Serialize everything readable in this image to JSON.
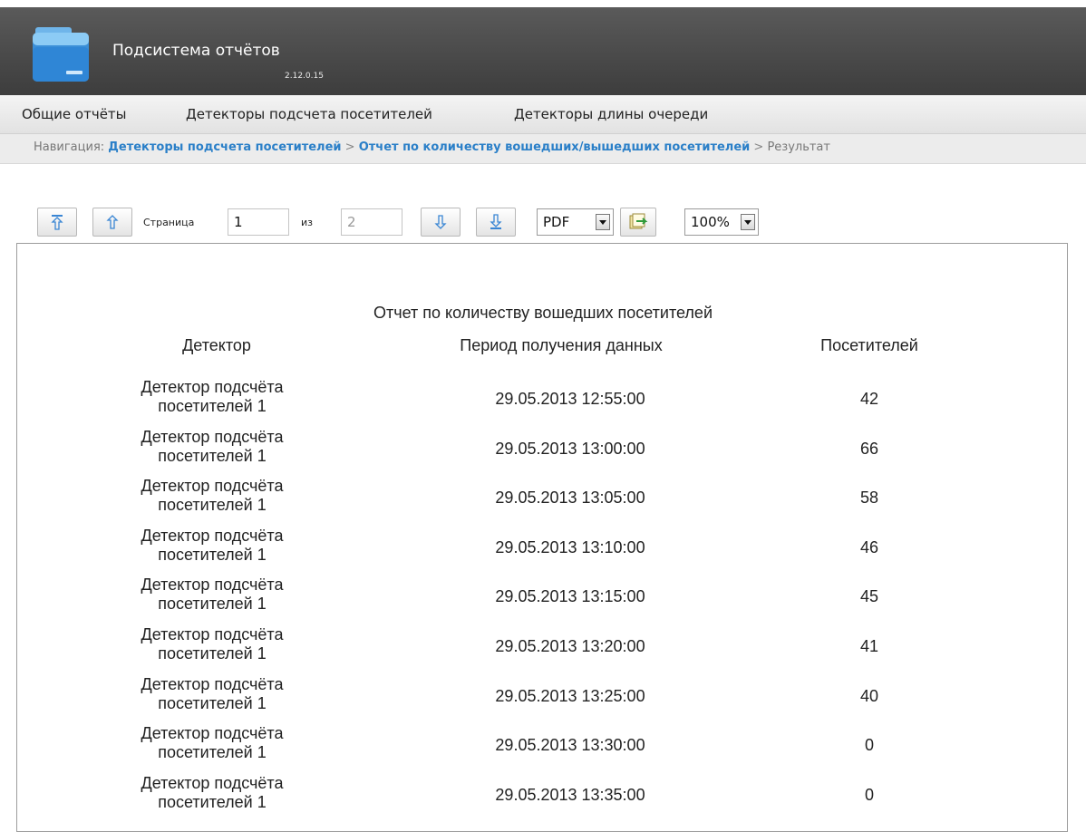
{
  "app": {
    "title": "Подсистема отчётов",
    "version": "2.12.0.15"
  },
  "menu": [
    {
      "label": "Общие отчёты"
    },
    {
      "label": "Детекторы подсчета посетителей"
    },
    {
      "label": "Детекторы длины очереди"
    }
  ],
  "breadcrumb": {
    "prefix": "Навигация:",
    "link1": "Детекторы подсчета посетителей",
    "sep": ">",
    "link2": "Отчет по количеству вошедших/вышедших посетителей",
    "current": "Результат"
  },
  "toolbar": {
    "page_label": "Страница",
    "page_value": "1",
    "of_label": "из",
    "total_pages": "2",
    "format": "PDF",
    "zoom": "100%"
  },
  "report": {
    "title": "Отчет по количеству вошедших посетителей",
    "columns": [
      "Детектор",
      "Период получения данных",
      "Посетителей"
    ],
    "rows": [
      {
        "detector_line1": "Детектор подсчёта",
        "detector_line2": "посетителей 1",
        "period": "29.05.2013 12:55:00",
        "visitors": "42"
      },
      {
        "detector_line1": "Детектор подсчёта",
        "detector_line2": "посетителей 1",
        "period": "29.05.2013 13:00:00",
        "visitors": "66"
      },
      {
        "detector_line1": "Детектор подсчёта",
        "detector_line2": "посетителей 1",
        "period": "29.05.2013 13:05:00",
        "visitors": "58"
      },
      {
        "detector_line1": "Детектор подсчёта",
        "detector_line2": "посетителей 1",
        "period": "29.05.2013 13:10:00",
        "visitors": "46"
      },
      {
        "detector_line1": "Детектор подсчёта",
        "detector_line2": "посетителей 1",
        "period": "29.05.2013 13:15:00",
        "visitors": "45"
      },
      {
        "detector_line1": "Детектор подсчёта",
        "detector_line2": "посетителей 1",
        "period": "29.05.2013 13:20:00",
        "visitors": "41"
      },
      {
        "detector_line1": "Детектор подсчёта",
        "detector_line2": "посетителей 1",
        "period": "29.05.2013 13:25:00",
        "visitors": "40"
      },
      {
        "detector_line1": "Детектор подсчёта",
        "detector_line2": "посетителей 1",
        "period": "29.05.2013 13:30:00",
        "visitors": "0"
      },
      {
        "detector_line1": "Детектор подсчёта",
        "detector_line2": "посетителей 1",
        "period": "29.05.2013 13:35:00",
        "visitors": "0"
      }
    ]
  },
  "colors": {
    "link": "#2a7fc8",
    "header_bg": "#4a4a4a",
    "arrow_blue": "#3a86d4"
  },
  "icons": [
    "app-folder-icon",
    "first-page-icon",
    "previous-page-icon",
    "next-page-icon",
    "last-page-icon",
    "export-icon",
    "dropdown-arrow-icon"
  ]
}
